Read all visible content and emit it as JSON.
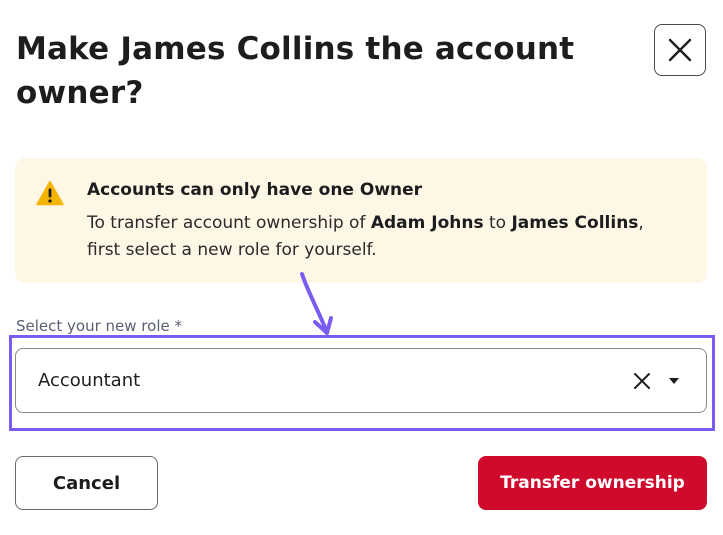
{
  "dialog": {
    "title": "Make James Collins the account owner?",
    "close_icon": "close-icon"
  },
  "alert": {
    "icon": "warning-icon",
    "icon_color": "#f5b400",
    "title": "Accounts can only have one Owner",
    "body_prefix": "To transfer account ownership of ",
    "current_owner": "Adam Johns",
    "body_middle": " to ",
    "new_owner": "James Collins",
    "body_suffix": ", first select a new role for yourself.",
    "background": "#fff7e6"
  },
  "role_field": {
    "label": "Select your new role *",
    "value": "Accountant",
    "clear_icon": "close-icon",
    "dropdown_icon": "caret-down-icon"
  },
  "annotation": {
    "color": "#7b5cf0"
  },
  "actions": {
    "cancel_label": "Cancel",
    "confirm_label": "Transfer ownership",
    "confirm_color": "#cf0a2c"
  }
}
